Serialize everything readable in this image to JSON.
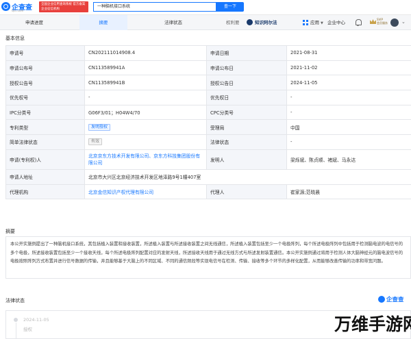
{
  "header": {
    "logo_text": "企查查",
    "logo_sub": "Qcc.com",
    "official_badge": "全国企业信用查询系统 官方备案企业征信机构",
    "search_value": "一种脑机接口系统",
    "search_button": "查一下"
  },
  "nav": {
    "tabs": [
      "申请进度",
      "摘要",
      "法律状态"
    ],
    "partial_tab": "权利要",
    "partner_brand": "知识阿尔法",
    "app_label": "应用",
    "enterprise_center": "企业中心",
    "svip_line1": "SVIP",
    "svip_line2": "会员服务"
  },
  "basic_info": {
    "section_title": "基本信息",
    "rows": [
      [
        "申请号",
        "CN202111014908.4",
        "申请日期",
        "2021-08-31"
      ],
      [
        "申请公布号",
        "CN113589941A",
        "申请公布日",
        "2021-11-02"
      ],
      [
        "授权公告号",
        "CN113589941B",
        "授权公告日",
        "2024-11-05"
      ],
      [
        "优先权号",
        "-",
        "优先权日",
        "-"
      ],
      [
        "IPC分类号",
        "G06F3/01；H04W4/70",
        "CPC分类号",
        "-"
      ],
      [
        "专利类型",
        "发明授权",
        "受理局",
        "中国"
      ],
      [
        "简单法律状态",
        "有效",
        "法律状态",
        "-"
      ],
      [
        "申请(专利权)人",
        "北京京东方技术开发有限公司、京东方科技集团股份有限公司",
        "发明人",
        "梁烁斌、陈贞顺、褚斌、马永达"
      ],
      [
        "申请人地址",
        "北京市大兴区北京经济技术开发区地泽路9号1幢407室",
        "",
        ""
      ],
      [
        "代理机构",
        "北京金信知识产权代理有限公司",
        "代理人",
        "崔家源;范晓晨"
      ]
    ]
  },
  "abstract": {
    "section_title": "摘要",
    "text": "本公开实施例提出了一种脑机接口系统，其包括植入装置和接收装置，所述植入装置与所述接收装置之间无线通信，所述植入装置包括至少一个电极阵列，每个所述电极阵列中包括用于检测脑电波的电信号的多个电极，所述接收装置包括至少一个接收天线，每个所述电极阵列配置对应的发射天线，所述接收天线用于通过无线方式与所述发射装置通信。本公开实施例通过将用于检测人体大脑神经元的脑电波信号的电极按照阵列方式布置并进行信号数据的传输，并且能够基于大脑上的不同区域、不同的通信频段等实现电信号在检测、传输、接收等多个环节的多样化配置，从而能够改善传输的功率和带宽问题。"
  },
  "legal_status": {
    "section_title": "法律状态",
    "logo_text": "企查查",
    "date": "2024-11-05",
    "event": "授权"
  },
  "watermark": "万维手游网",
  "colors": {
    "brand_blue": "#1677ff",
    "official_red": "#e8403c",
    "label_bg": "#f4f6fa",
    "border": "#e4e6ea"
  }
}
